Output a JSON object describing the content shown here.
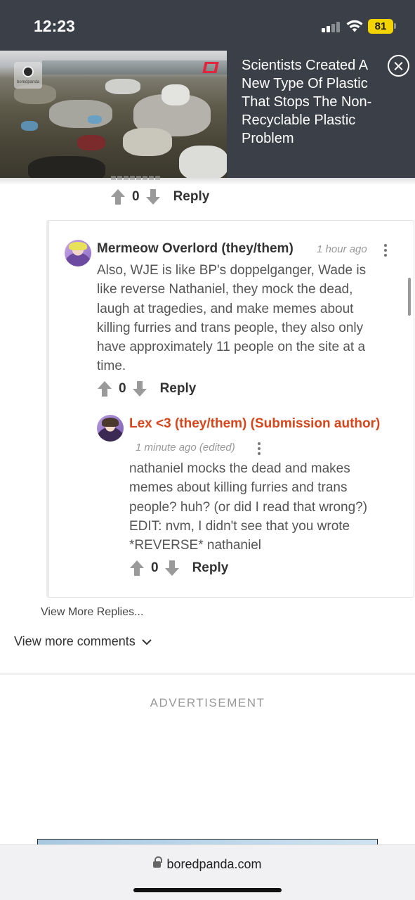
{
  "status_bar": {
    "time": "12:23",
    "battery": "81",
    "battery_color": "#f3d400",
    "icons": [
      "cellular-signal-icon",
      "wifi-icon",
      "battery-icon"
    ]
  },
  "ad_banner": {
    "headline": "Scientists Created A New Type Of Plastic That Stops The Non-Recyclable Plastic Problem",
    "logo_text": "boredpanda",
    "close_icon": "close-icon"
  },
  "parent_comment": {
    "score": "0",
    "reply_label": "Reply"
  },
  "comments": [
    {
      "author": "Mermeow Overlord (they/them)",
      "timestamp": "1 hour ago",
      "body": "Also, WJE is like BP's doppelganger, Wade is like reverse Nathaniel, they mock the dead, laugh at tragedies, and make memes about killing furries and trans people, they also only have approximately 11 people on the site at a time.",
      "score": "0",
      "reply_label": "Reply"
    },
    {
      "author": "Lex <3 (they/them) (Submission author)",
      "author_color": "#d6461c",
      "timestamp": "1 minute ago (edited)",
      "body": "nathaniel mocks the dead and makes memes about killing furries and trans people? huh? (or did I read that wrong?) EDIT: nvm, I didn't see that you wrote *REVERSE* nathaniel",
      "score": "0",
      "reply_label": "Reply"
    }
  ],
  "view_more_replies": "View More Replies...",
  "view_more_comments": "View more comments",
  "advertisement_label": "ADVERTISEMENT",
  "browser": {
    "url": "boredpanda.com"
  }
}
